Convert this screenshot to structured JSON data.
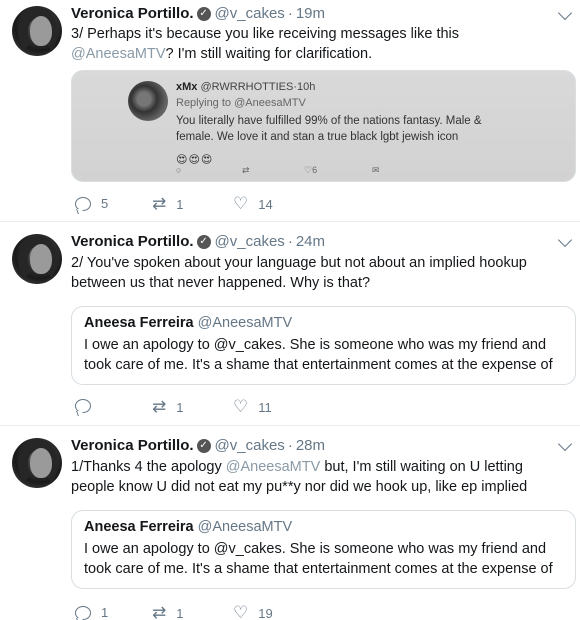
{
  "tweets": [
    {
      "author": "Veronica Portillo.",
      "handle": "@v_cakes",
      "time": "19m",
      "text_before": "3/ Perhaps it's because you like receiving messages like this ",
      "mention": "@AneesaMTV",
      "text_after": "? I'm still waiting for clarification.",
      "quoted_image": {
        "name": "xMx",
        "handle": "@RWRRHOTTIES",
        "time": "10h",
        "replying_to_label": "Replying to",
        "replying_to": "@AneesaMTV",
        "body": "You literally have fulfilled 99% of the nations fantasy. Male & female. We love it and stan a true black lgbt jewish icon",
        "emoji": "😍😍😍",
        "likes": "6"
      },
      "replies": "5",
      "retweets": "1",
      "likes": "14"
    },
    {
      "author": "Veronica Portillo.",
      "handle": "@v_cakes",
      "time": "24m",
      "text": "2/ You've spoken about your language but not about an implied hookup between us that never happened. Why is that?",
      "quote": {
        "name": "Aneesa Ferreira",
        "handle": "@AneesaMTV",
        "body": "I owe an apology to @v_cakes. She is someone who was my friend and took care of me. It's a shame that entertainment comes at the expense of"
      },
      "replies": "",
      "retweets": "1",
      "likes": "11"
    },
    {
      "author": "Veronica Portillo.",
      "handle": "@v_cakes",
      "time": "28m",
      "text_before": "1/Thanks 4 the apology ",
      "mention": "@AneesaMTV",
      "text_after": " but, I'm still waiting on U letting people know U did not eat my pu**y nor did we hook up, like ep implied",
      "quote": {
        "name": "Aneesa Ferreira",
        "handle": "@AneesaMTV",
        "body": "I owe an apology to @v_cakes. She is someone who was my friend and took care of me. It's a shame that entertainment comes at the expense of"
      },
      "replies": "1",
      "retweets": "1",
      "likes": "19"
    }
  ]
}
